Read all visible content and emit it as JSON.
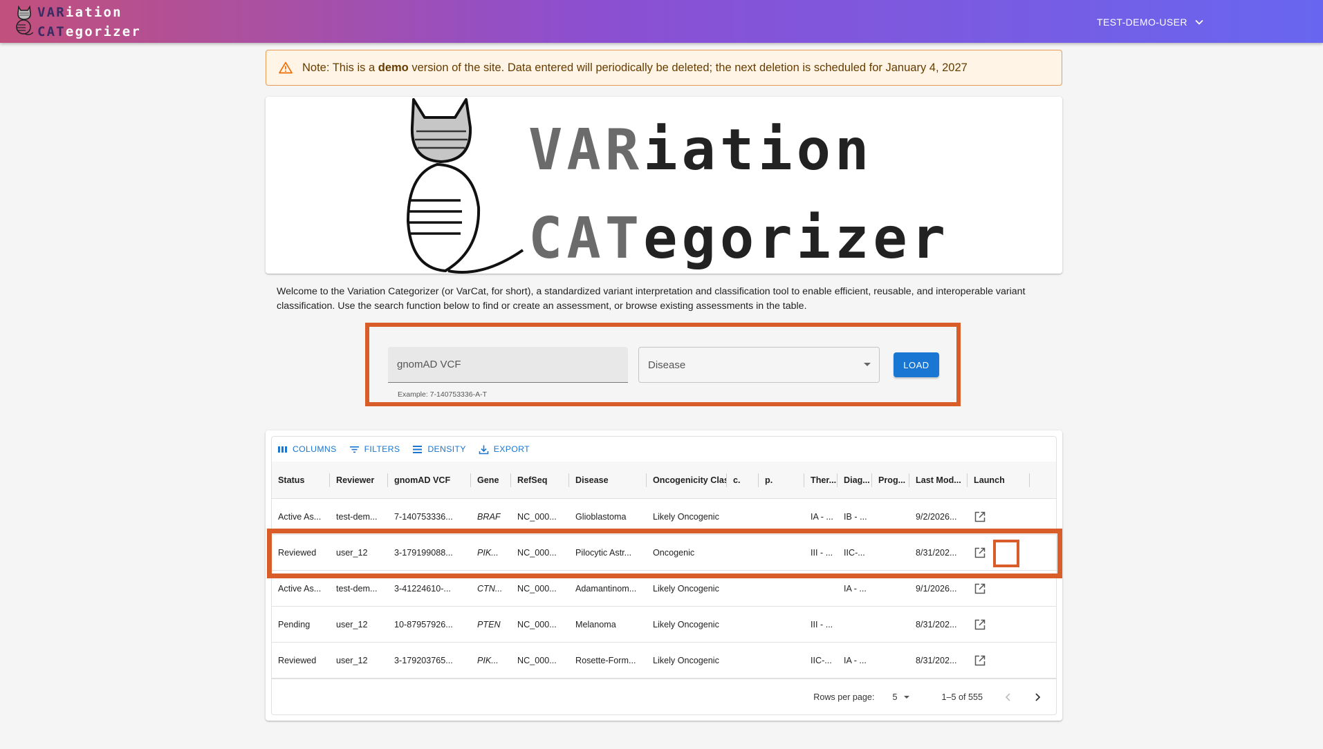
{
  "header": {
    "brand_line1_bold": "VAR",
    "brand_line1_rest": "iation",
    "brand_line2_bold": "CAT",
    "brand_line2_rest": "egorizer",
    "user": "TEST-DEMO-USER",
    "logo_icon": "cat-logo-icon",
    "user_menu_icon": "chevron-down-icon",
    "gradient": [
      "#c2507c",
      "#8c4fd1",
      "#6866f0"
    ]
  },
  "alert": {
    "icon": "warning-icon",
    "prefix": "Note: This is a ",
    "bold": "demo",
    "suffix": " version of the site. Data entered will periodically be deleted; the next deletion is scheduled for January 4, 2027"
  },
  "logo": {
    "line1_dim": "VAR",
    "line1_rest": "iation",
    "line2_dim": "CAT",
    "line2_rest": "egorizer"
  },
  "welcome": "Welcome to the Variation Categorizer (or VarCat, for short), a standardized variant interpretation and classification tool to enable efficient, reusable, and interoperable variant classification. Use the search function below to find or create an assessment, or browse existing assessments in the table.",
  "search": {
    "vcf_placeholder": "gnomAD VCF",
    "vcf_helper": "Example: 7-140753336-A-T",
    "disease_placeholder": "Disease",
    "load_label": "LOAD",
    "highlight_color": "#d95d28"
  },
  "toolbar": {
    "columns": "COLUMNS",
    "filters": "FILTERS",
    "density": "DENSITY",
    "export": "EXPORT"
  },
  "table": {
    "columns": [
      "Status",
      "Reviewer",
      "gnomAD VCF",
      "Gene",
      "RefSeq",
      "Disease",
      "Oncogenicity Clas...",
      "c.",
      "p.",
      "Ther...",
      "Diag...",
      "Prog...",
      "Last Mod...",
      "Launch"
    ],
    "rows": [
      [
        "Active As...",
        "test-dem...",
        "7-140753336...",
        "BRAF",
        "NC_000...",
        "Glioblastoma",
        "Likely Oncogenic",
        "",
        "",
        "IA - ...",
        "IB - ...",
        "",
        "9/2/2026...",
        ""
      ],
      [
        "Reviewed",
        "user_12",
        "3-179199088...",
        "PIK...",
        "NC_000...",
        "Pilocytic Astr...",
        "Oncogenic",
        "",
        "",
        "III - ...",
        "IIC-...",
        "",
        "8/31/202...",
        ""
      ],
      [
        "Active As...",
        "test-dem...",
        "3-41224610-...",
        "CTN...",
        "NC_000...",
        "Adamantinom...",
        "Likely Oncogenic",
        "",
        "",
        "",
        "IA - ...",
        "",
        "9/1/2026...",
        ""
      ],
      [
        "Pending",
        "user_12",
        "10-87957926...",
        "PTEN",
        "NC_000...",
        "Melanoma",
        "Likely Oncogenic",
        "",
        "",
        "III - ...",
        "",
        "",
        "8/31/202...",
        ""
      ],
      [
        "Reviewed",
        "user_12",
        "3-179203765...",
        "PIK...",
        "NC_000...",
        "Rosette-Form...",
        "Likely Oncogenic",
        "",
        "",
        "IIC-...",
        "IA - ...",
        "",
        "8/31/202...",
        ""
      ]
    ],
    "launch_icon": "open-in-new-icon",
    "highlighted_row": 1
  },
  "pagination": {
    "rows_per_page_label": "Rows per page:",
    "rows_per_page": "5",
    "range": "1–5 of 555",
    "prev_icon": "chevron-left-icon",
    "next_icon": "chevron-right-icon"
  }
}
